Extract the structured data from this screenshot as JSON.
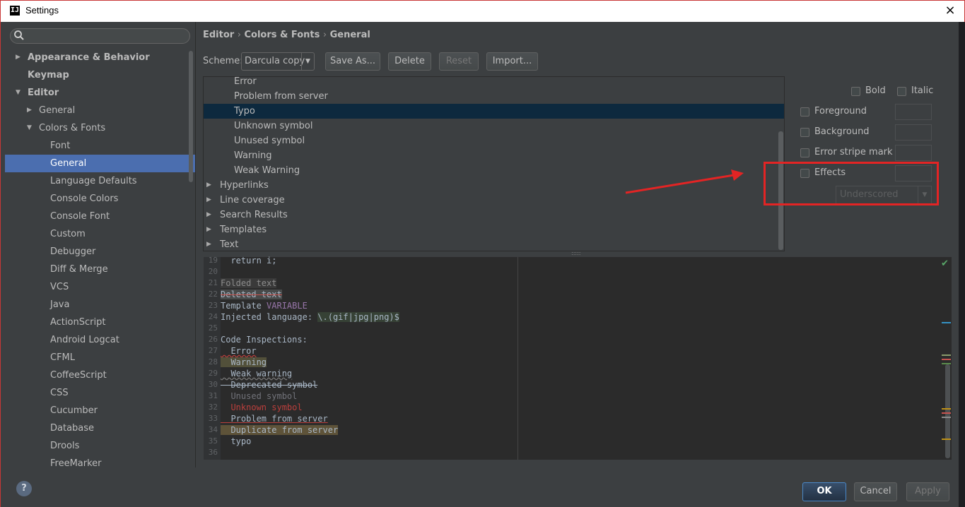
{
  "window": {
    "title": "Settings",
    "logo": "IJ",
    "close_glyph": "×"
  },
  "search": {
    "placeholder": ""
  },
  "sidebar": {
    "items": [
      {
        "label": "Appearance & Behavior",
        "bold": true,
        "arrow": "right"
      },
      {
        "label": "Keymap",
        "bold": true
      },
      {
        "label": "Editor",
        "bold": true,
        "arrow": "down"
      },
      {
        "label": "General",
        "arrow": "right"
      },
      {
        "label": "Colors & Fonts",
        "arrow": "down"
      },
      {
        "label": "Font"
      },
      {
        "label": "General",
        "selected": true
      },
      {
        "label": "Language Defaults"
      },
      {
        "label": "Console Colors"
      },
      {
        "label": "Console Font"
      },
      {
        "label": "Custom"
      },
      {
        "label": "Debugger"
      },
      {
        "label": "Diff & Merge"
      },
      {
        "label": "VCS"
      },
      {
        "label": "Java"
      },
      {
        "label": "ActionScript"
      },
      {
        "label": "Android Logcat"
      },
      {
        "label": "CFML"
      },
      {
        "label": "CoffeeScript"
      },
      {
        "label": "CSS"
      },
      {
        "label": "Cucumber"
      },
      {
        "label": "Database"
      },
      {
        "label": "Drools"
      },
      {
        "label": "FreeMarker"
      }
    ]
  },
  "breadcrumb": [
    "Editor",
    "Colors & Fonts",
    "General"
  ],
  "breadcrumb_sep": "›",
  "scheme": {
    "label": "Scheme:",
    "value": "Darcula copy"
  },
  "buttons": {
    "save_as": "Save As...",
    "delete": "Delete",
    "reset": "Reset",
    "import": "Import..."
  },
  "attributes": [
    {
      "label": "Error"
    },
    {
      "label": "Problem from server"
    },
    {
      "label": "Typo",
      "selected": true
    },
    {
      "label": "Unknown symbol"
    },
    {
      "label": "Unused symbol"
    },
    {
      "label": "Warning"
    },
    {
      "label": "Weak Warning"
    },
    {
      "label": "Hyperlinks",
      "group": true
    },
    {
      "label": "Line coverage",
      "group": true
    },
    {
      "label": "Search Results",
      "group": true
    },
    {
      "label": "Templates",
      "group": true
    },
    {
      "label": "Text",
      "group": true
    }
  ],
  "options": {
    "bold": "Bold",
    "italic": "Italic",
    "foreground": "Foreground",
    "background": "Background",
    "error_stripe": "Error stripe mark",
    "effects": "Effects",
    "effects_type": "Underscored"
  },
  "preview": {
    "lines": [
      {
        "n": "19",
        "text": "  return i;"
      },
      {
        "n": "20",
        "text": ""
      },
      {
        "n": "21",
        "text": "Folded text"
      },
      {
        "n": "22",
        "text": "Deleted text"
      },
      {
        "n": "23",
        "text": "Template ",
        "extra": "VARIABLE"
      },
      {
        "n": "24",
        "text": "Injected language: ",
        "extra": "\\.(gif|jpg|png)$"
      },
      {
        "n": "25",
        "text": ""
      },
      {
        "n": "26",
        "text": "Code Inspections:"
      },
      {
        "n": "27",
        "text": "  Error"
      },
      {
        "n": "28",
        "text": "  Warning"
      },
      {
        "n": "29",
        "text": "  Weak warning"
      },
      {
        "n": "30",
        "text": "  Deprecated symbol"
      },
      {
        "n": "31",
        "text": "  Unused symbol"
      },
      {
        "n": "32",
        "text": "  Unknown symbol"
      },
      {
        "n": "33",
        "text": "  Problem from server"
      },
      {
        "n": "34",
        "text": "  Duplicate from server"
      },
      {
        "n": "35",
        "text": "  typo"
      },
      {
        "n": "36",
        "text": ""
      }
    ]
  },
  "footer": {
    "help": "?",
    "ok": "OK",
    "cancel": "Cancel",
    "apply": "Apply"
  },
  "colors": {
    "selection": "#4b6eaf",
    "annotation": "#e32424",
    "ok_border": "#4a88c7"
  }
}
